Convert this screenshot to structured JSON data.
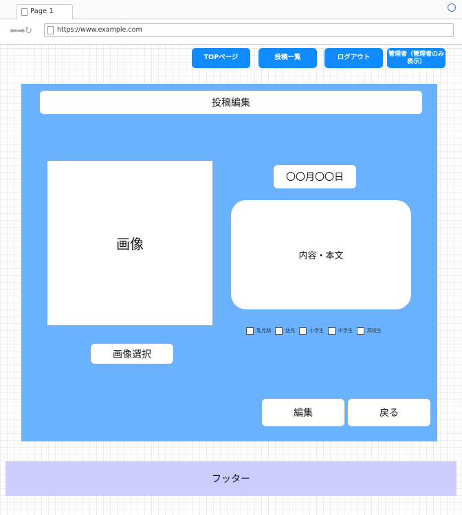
{
  "browser": {
    "tab_title": "Page 1",
    "url": "https://www.example.com"
  },
  "nav": {
    "top": "TOPページ",
    "posts": "投稿一覧",
    "logout": "ログアウト",
    "admin": "管理者（管理者のみ表示）"
  },
  "form": {
    "title": "投稿編集",
    "image": "画像",
    "image_select": "画像選択",
    "date": "〇〇月〇〇日",
    "content": "内容・本文",
    "checkboxes": [
      "乳児期",
      "幼児",
      "小学生",
      "中学生",
      "高校生"
    ],
    "edit": "編集",
    "back": "戻る"
  },
  "footer": {
    "label": "フッター"
  },
  "colors": {
    "accent": "#0f8bff",
    "panel": "#6ab2ff",
    "footer": "#ccccff"
  }
}
